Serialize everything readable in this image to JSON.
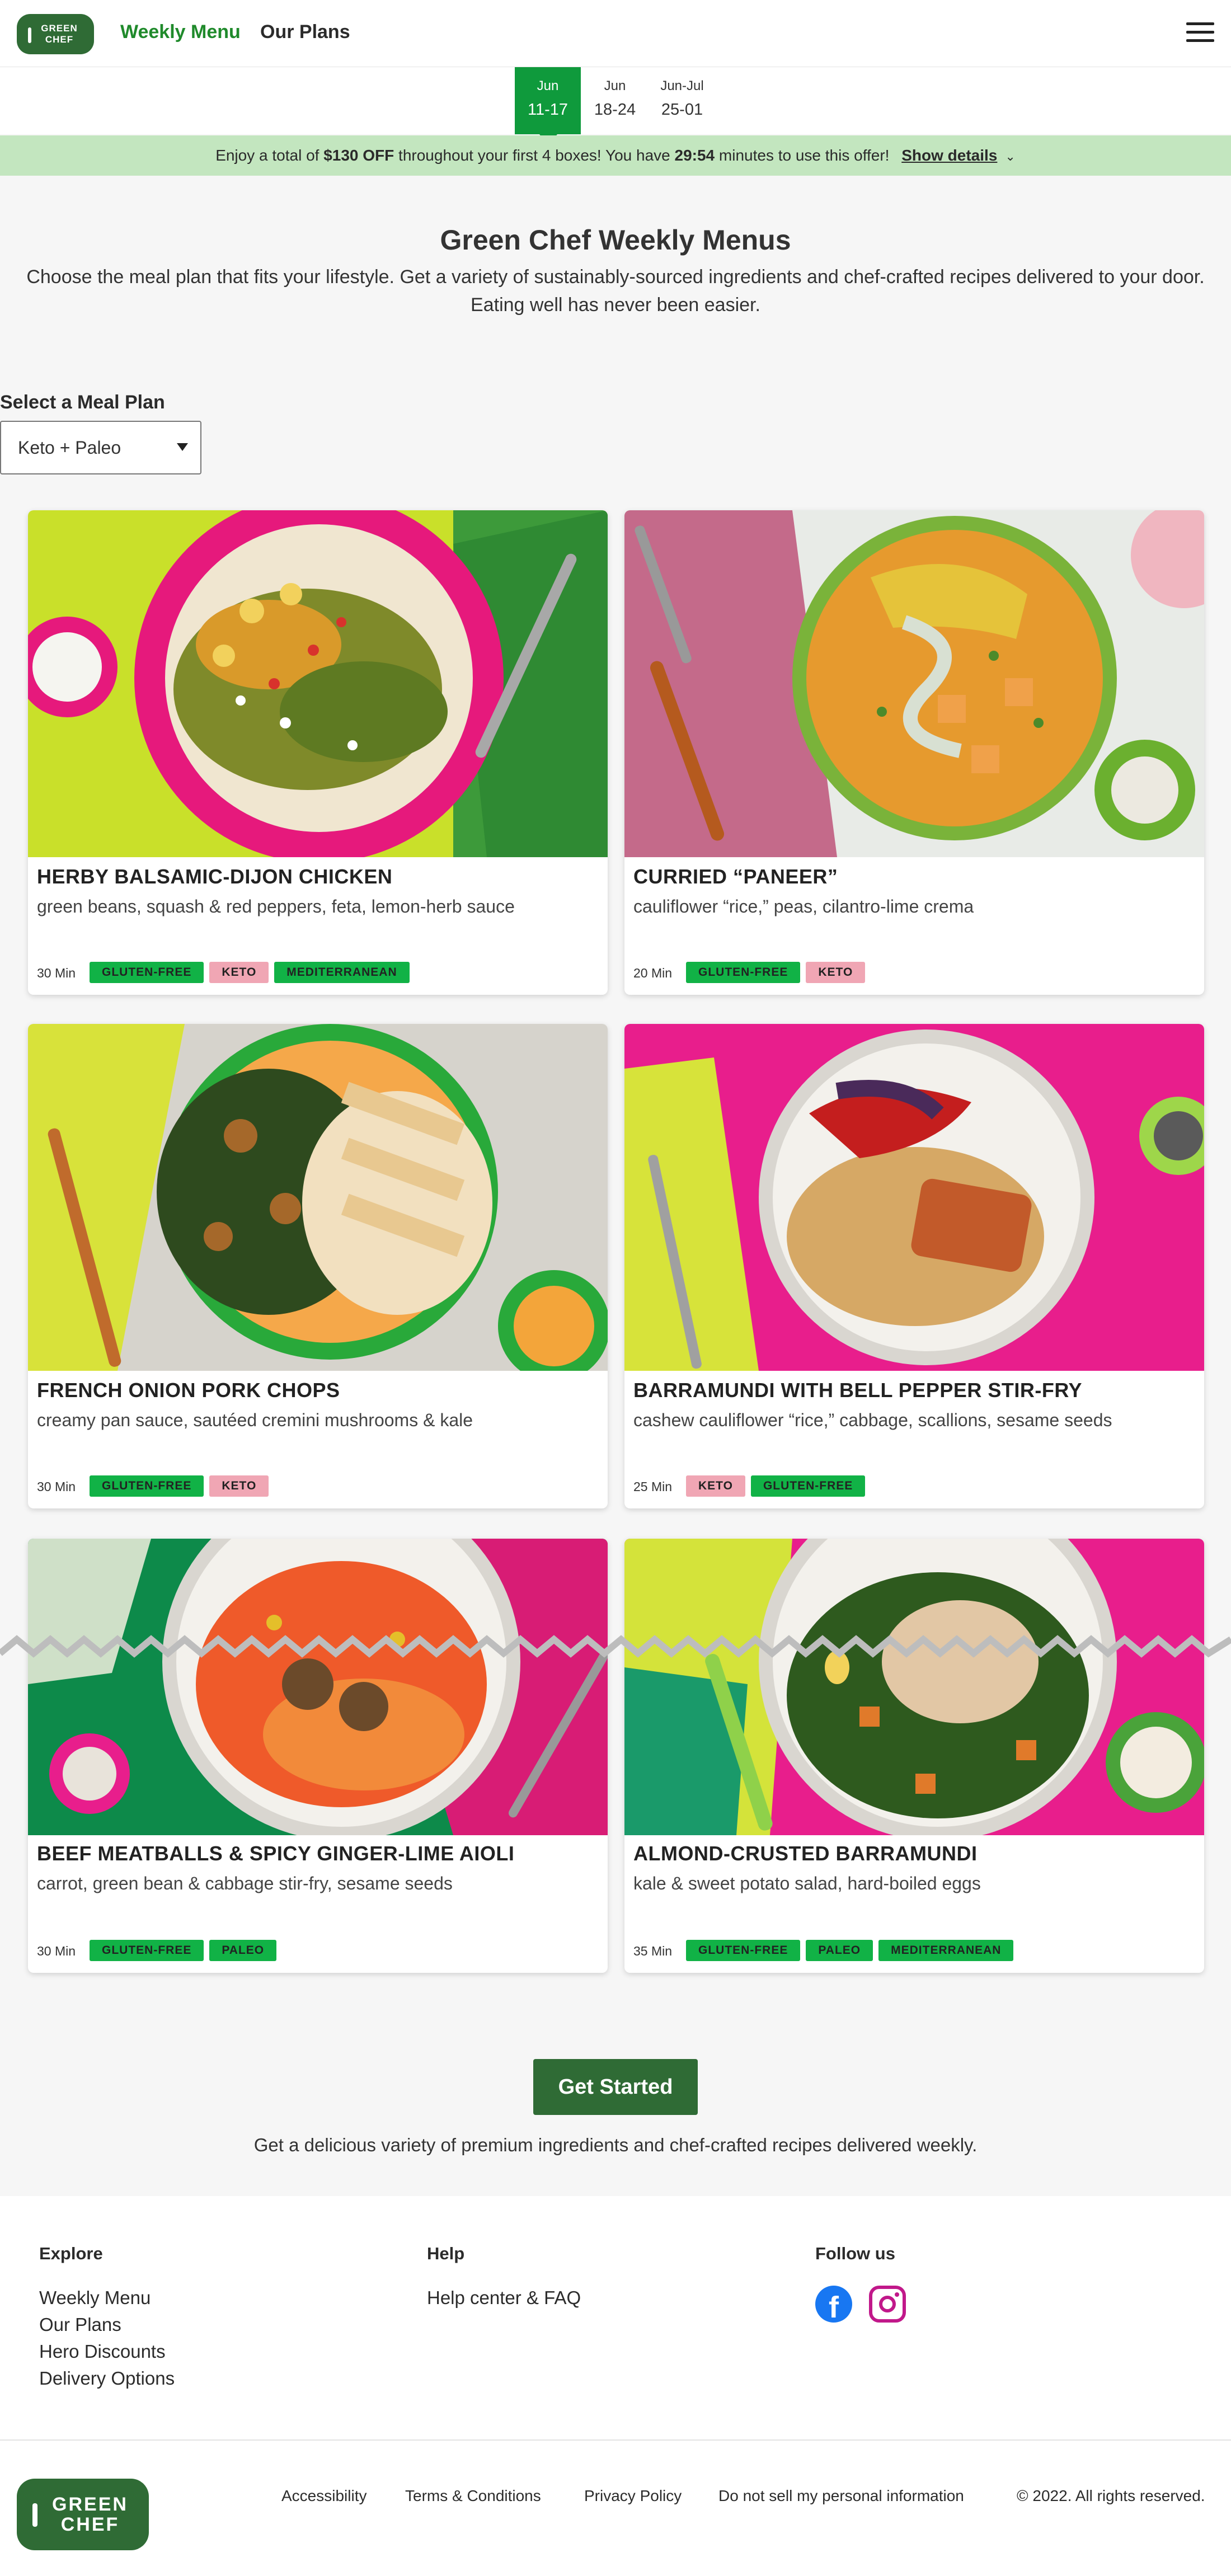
{
  "header": {
    "logo_line1": "GREEN",
    "logo_line2": "CHEF",
    "nav": [
      "Weekly Menu",
      "Our Plans"
    ]
  },
  "weeks": [
    {
      "month": "Jun",
      "days": "11-17",
      "active": true
    },
    {
      "month": "Jun",
      "days": "18-24",
      "active": false
    },
    {
      "month": "Jun-Jul",
      "days": "25-01",
      "active": false
    }
  ],
  "promo": {
    "prefix": "Enjoy a total of ",
    "amount": "$130 OFF",
    "middle": " throughout your first 4 boxes! You have ",
    "timer": "29:54",
    "suffix": " minutes to use this offer!",
    "link": "Show details"
  },
  "intro": {
    "title": "Green Chef Weekly Menus",
    "text": "Choose the meal plan that fits your lifestyle. Get a variety of sustainably-sourced ingredients and chef-crafted recipes delivered to your door. Eating well has never been easier."
  },
  "meal_plan": {
    "label": "Select a Meal Plan",
    "selected": "Keto + Paleo"
  },
  "recipes": [
    {
      "title": "HERBY BALSAMIC-DIJON CHICKEN",
      "desc": "green beans, squash & red peppers, feta, lemon-herb sauce",
      "time": "30 Min",
      "tags": [
        {
          "label": "GLUTEN-FREE",
          "color": "green"
        },
        {
          "label": "KETO",
          "color": "pink"
        },
        {
          "label": "MEDITERRANEAN",
          "color": "green"
        }
      ]
    },
    {
      "title": "CURRIED “PANEER”",
      "desc": "cauliflower “rice,” peas, cilantro-lime crema",
      "time": "20 Min",
      "tags": [
        {
          "label": "GLUTEN-FREE",
          "color": "green"
        },
        {
          "label": "KETO",
          "color": "pink"
        }
      ]
    },
    {
      "title": "FRENCH ONION PORK CHOPS",
      "desc": "creamy pan sauce, sautéed cremini mushrooms & kale",
      "time": "30 Min",
      "tags": [
        {
          "label": "GLUTEN-FREE",
          "color": "green"
        },
        {
          "label": "KETO",
          "color": "pink"
        }
      ]
    },
    {
      "title": "BARRAMUNDI WITH BELL PEPPER STIR-FRY",
      "desc": "cashew cauliflower “rice,” cabbage, scallions, sesame seeds",
      "time": "25 Min",
      "tags": [
        {
          "label": "KETO",
          "color": "pink"
        },
        {
          "label": "GLUTEN-FREE",
          "color": "green"
        }
      ]
    },
    {
      "title": "BEEF MEATBALLS & SPICY GINGER-LIME AIOLI",
      "desc": "carrot, green bean & cabbage stir-fry, sesame seeds",
      "time": "30 Min",
      "tags": [
        {
          "label": "GLUTEN-FREE",
          "color": "green"
        },
        {
          "label": "PALEO",
          "color": "green"
        }
      ]
    },
    {
      "title": "ALMOND-CRUSTED BARRAMUNDI",
      "desc": "kale & sweet potato salad, hard-boiled eggs",
      "time": "35 Min",
      "tags": [
        {
          "label": "GLUTEN-FREE",
          "color": "green"
        },
        {
          "label": "PALEO",
          "color": "green"
        },
        {
          "label": "MEDITERRANEAN",
          "color": "green"
        }
      ]
    }
  ],
  "cta": {
    "button": "Get Started",
    "text": "Get a delicious variety of premium ingredients and chef-crafted recipes delivered weekly."
  },
  "footer": {
    "explore_heading": "Explore",
    "explore_links": [
      "Weekly Menu",
      "Our Plans",
      "Hero Discounts",
      "Delivery Options"
    ],
    "help_heading": "Help",
    "help_links": [
      "Help center & FAQ"
    ],
    "follow_heading": "Follow us",
    "social_icons": [
      "facebook-icon",
      "instagram-icon"
    ],
    "legal_links": [
      "Accessibility",
      "Terms & Conditions",
      "Privacy Policy",
      "Do not sell my personal information"
    ],
    "copyright": "© 2022. All rights reserved."
  },
  "colors": {
    "brand_green": "#2f6b35",
    "accent_green": "#0f9a3c",
    "promo_bg": "#c3e6bf",
    "tag_green": "#11b246",
    "tag_pink": "#f0a6b4"
  }
}
